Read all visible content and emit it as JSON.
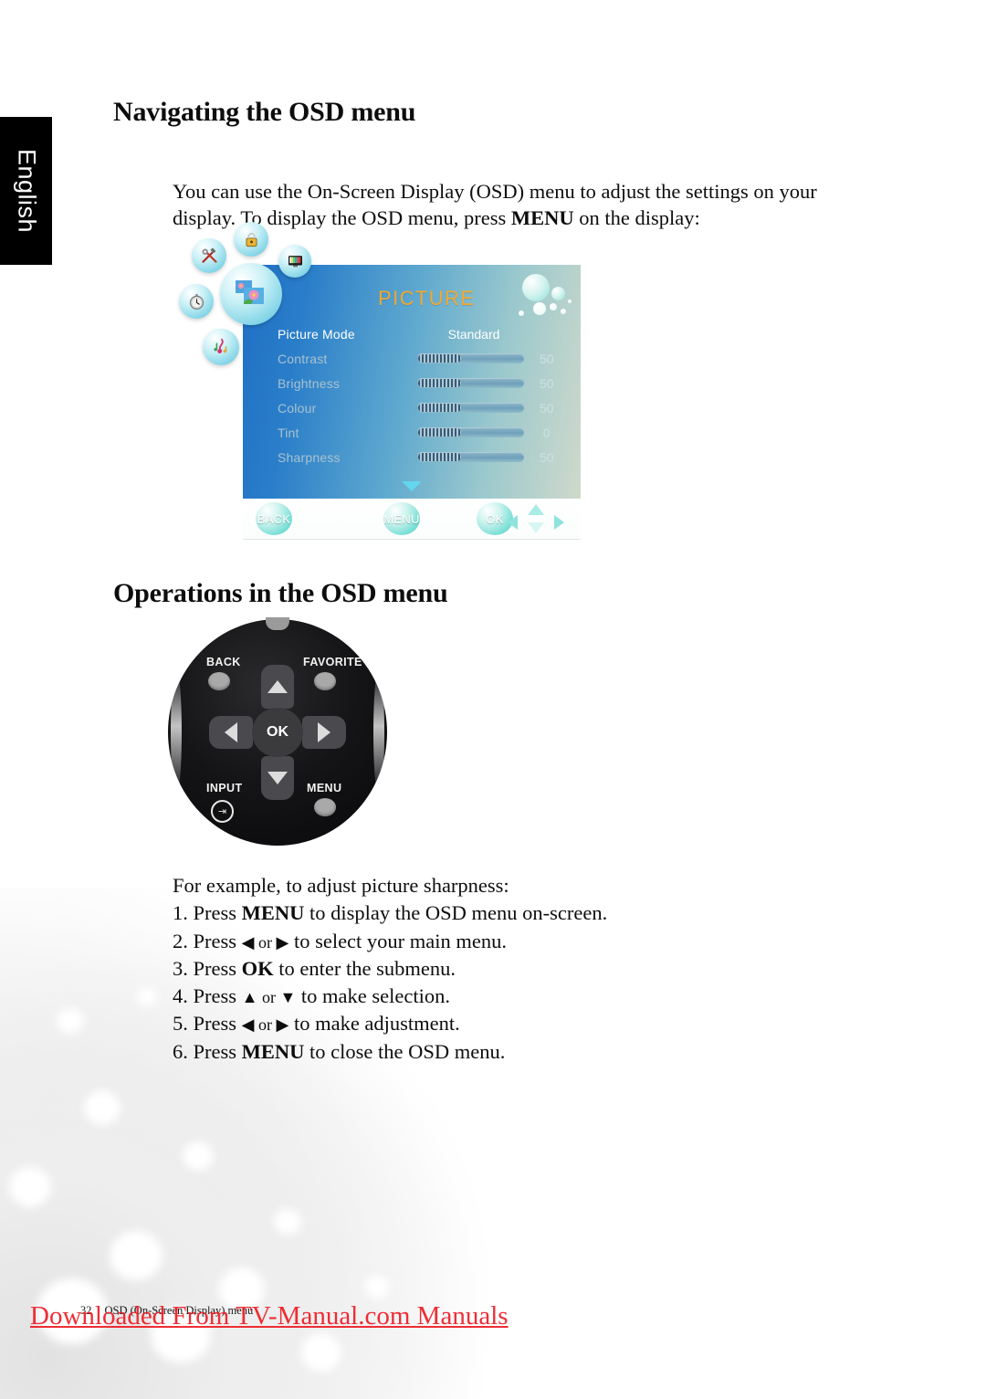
{
  "language_tab": {
    "label": "English"
  },
  "headings": {
    "navigating": "Navigating the OSD menu",
    "operations": "Operations in the OSD menu"
  },
  "intro": {
    "part1": "You can use the On-Screen Display (OSD) menu to adjust the settings on your display. To display the OSD menu, press ",
    "bold": "MENU",
    "part2": " on the display:"
  },
  "osd": {
    "title": "PICTURE",
    "menu_icons": [
      {
        "name": "lock-icon",
        "glyph": "🔒"
      },
      {
        "name": "tv-color-bars-icon",
        "glyph": "📺"
      },
      {
        "name": "tools-icon",
        "glyph": "🛠"
      },
      {
        "name": "timer-clock-icon",
        "glyph": "⏱"
      },
      {
        "name": "music-notes-icon",
        "glyph": "🎵"
      },
      {
        "name": "picture-flowers-icon",
        "glyph": "🌸"
      }
    ],
    "rows": [
      {
        "label": "Picture Mode",
        "value": "Standard",
        "type": "text",
        "active": true
      },
      {
        "label": "Contrast",
        "value": "50",
        "type": "slider",
        "fill_pct": 40
      },
      {
        "label": "Brightness",
        "value": "50",
        "type": "slider",
        "fill_pct": 40
      },
      {
        "label": "Colour",
        "value": "50",
        "type": "slider",
        "fill_pct": 40
      },
      {
        "label": "Tint",
        "value": "0",
        "type": "slider",
        "fill_pct": 40
      },
      {
        "label": "Sharpness",
        "value": "50",
        "type": "slider",
        "fill_pct": 40
      }
    ],
    "buttons": {
      "back": "BACK",
      "menu": "MENU",
      "ok": "OK"
    },
    "colors": {
      "title": "#f0a830",
      "panel_left": "#1f6fc4",
      "panel_right": "#cfd9cb",
      "button": "#46c9c2"
    }
  },
  "remote": {
    "labels": {
      "back": "BACK",
      "favorite": "FAVORITE",
      "input": "INPUT",
      "menu": "MENU",
      "ok": "OK"
    }
  },
  "steps": {
    "intro": "For example, to adjust picture sharpness:",
    "items": [
      {
        "num": "1. ",
        "pre": "Press ",
        "bold": "MENU",
        "post": " to display the OSD menu on-screen."
      },
      {
        "num": "2. ",
        "pre": "Press ",
        "arrows": "◀ or ▶",
        "post": " to select your main menu."
      },
      {
        "num": "3. ",
        "pre": "Press ",
        "bold": "OK",
        "post": " to enter the submenu."
      },
      {
        "num": "4. ",
        "pre": "Press ",
        "arrows": "▲ or ▼",
        "post": " to make selection."
      },
      {
        "num": "5. ",
        "pre": "Press ",
        "arrows": "◀ or ▶",
        "post": " to make adjustment."
      },
      {
        "num": "6. ",
        "pre": "Press ",
        "bold": "MENU",
        "post": " to close the OSD menu."
      }
    ]
  },
  "footer": {
    "page_number": "32",
    "section": "OSD (On-Screen Display) menu",
    "watermark": "Downloaded From TV-Manual.com Manuals",
    "watermark_color": "#ee1c25"
  }
}
